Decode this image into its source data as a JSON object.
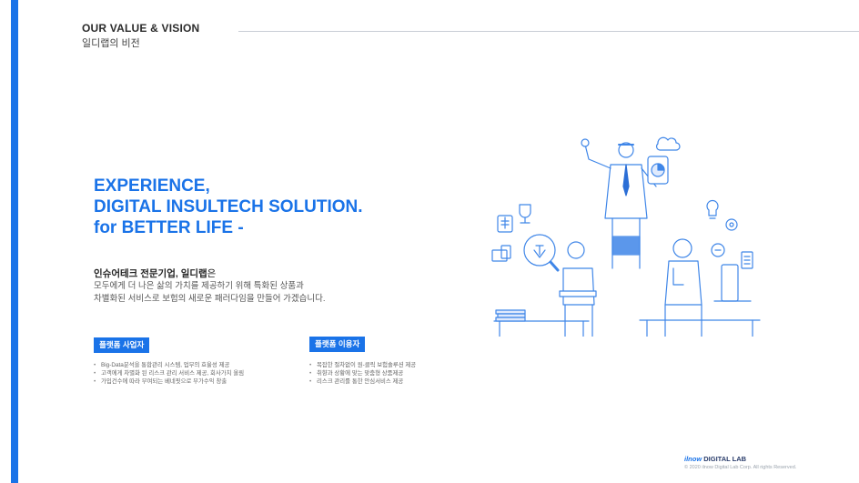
{
  "header": {
    "title": "OUR VALUE & VISION",
    "subtitle": "일디랩의 비전"
  },
  "headline": {
    "line1": "EXPERIENCE,",
    "line2": "DIGITAL INSULTECH SOLUTION.",
    "line3": "for BETTER LIFE -"
  },
  "intro": {
    "strong": "인슈어테크 전문기업, 일디랩",
    "tail": "은",
    "line2": "모두에게 더 나은 삶의 가치를 제공하기 위해 특화된 상품과",
    "line3": "차별화된 서비스로 보험의 새로운 패러다임을 만들어 가겠습니다."
  },
  "platform_business": {
    "badge": "플랫폼 사업자",
    "bullets": [
      "Big-Data분석을 통합관리 시스템, 업무의 효율성 제공",
      "고객에게 차별화 된 리스크 관리 서비스 제공, 회사가치 올림",
      "가입건수에 따라 부여되는 베네핏으로 부가수익 창출"
    ]
  },
  "platform_user": {
    "badge": "플랫폼 이용자",
    "bullets": [
      "복잡한 절차없이 원-클릭 보험솔루션 제공",
      "취향과 상황에 맞는 맞춤형 상품제공",
      "리스크 관리를 통한 안심서비스 제공"
    ]
  },
  "footer": {
    "brand_highlight": "ilnow",
    "brand_rest": "DIGITAL LAB",
    "copyright": "© 2020 ilnow Digital Lab Corp. All rights Reserved."
  },
  "colors": {
    "accent": "#1a73e8",
    "text": "#333333",
    "line": "#c9ced6"
  }
}
